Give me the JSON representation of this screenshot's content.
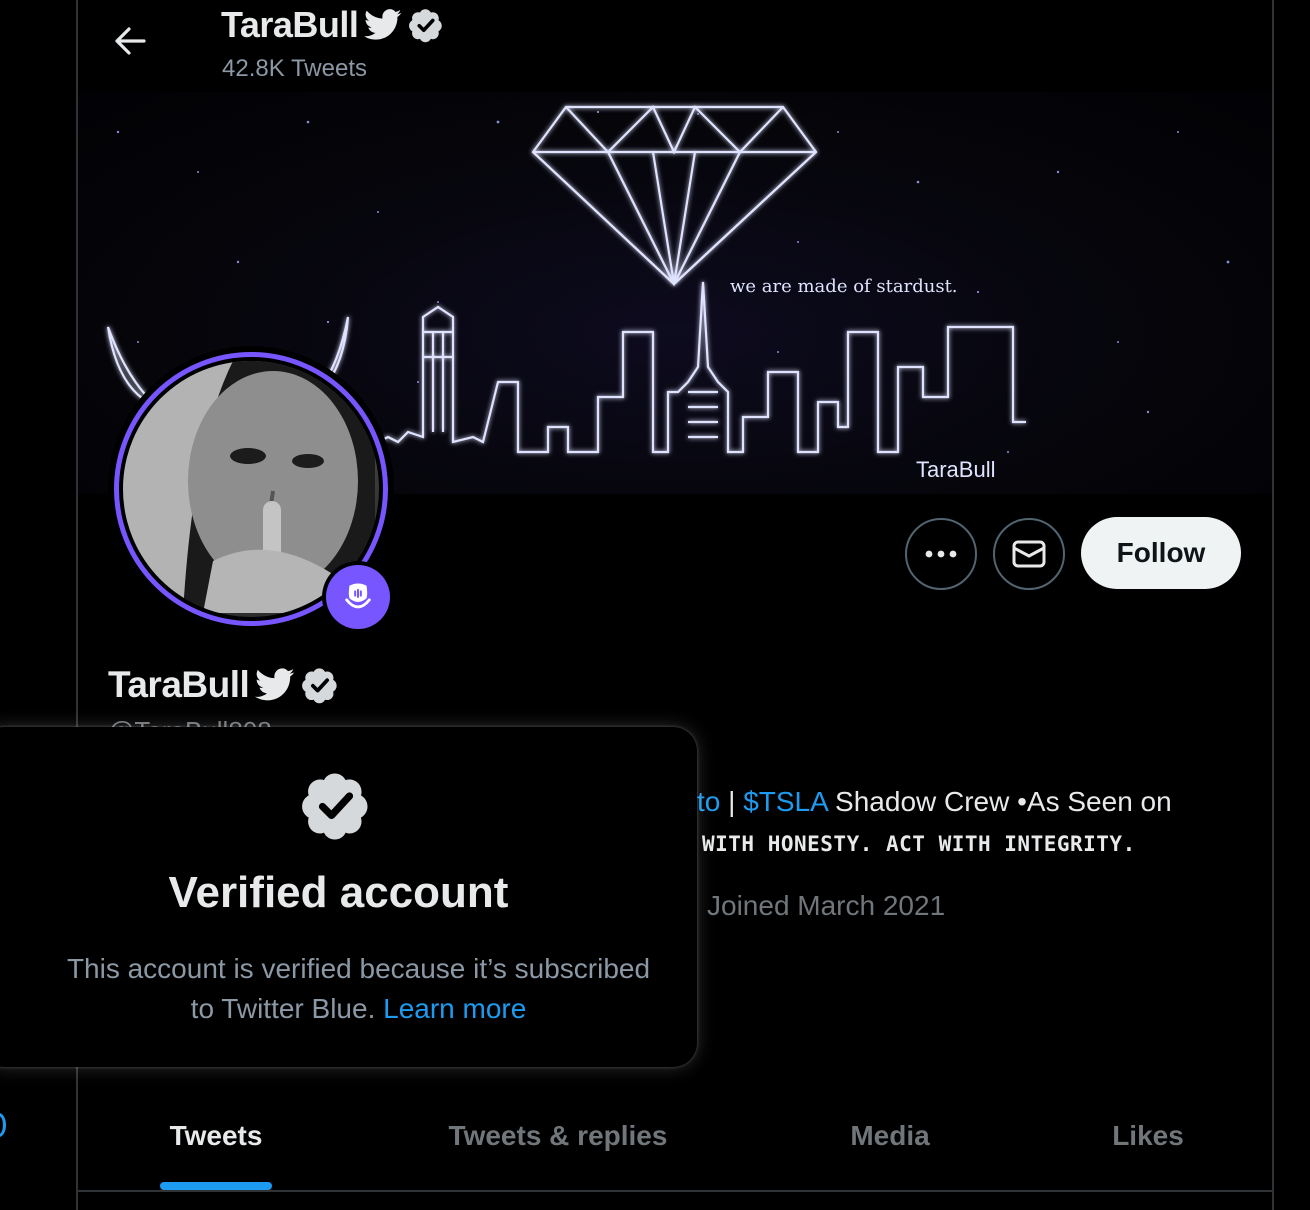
{
  "header": {
    "name": "TaraBull",
    "tweet_count": "42.8K Tweets"
  },
  "banner": {
    "tagline": "we are made of stardust.",
    "signature": "TaraBull"
  },
  "profile": {
    "name": "TaraBull",
    "handle": "@TaraBull808",
    "bio_fragment": "to",
    "bio_separator": " | ",
    "bio_link": "$TSLA",
    "bio_rest": " Shadow Crew •As Seen on",
    "bio_line2": "WITH HONESTY. ACT WITH INTEGRITY.",
    "joined": "Joined March 2021"
  },
  "actions": {
    "follow_label": "Follow"
  },
  "tabs": [
    {
      "label": "Tweets",
      "active": true
    },
    {
      "label": "Tweets & replies",
      "active": false
    },
    {
      "label": "Media",
      "active": false
    },
    {
      "label": "Likes",
      "active": false
    }
  ],
  "verified_card": {
    "title": "Verified account",
    "description_line1": "This account is verified because it’s subscribed",
    "description_line2": "to Twitter Blue.",
    "learn_more": "Learn more"
  },
  "colors": {
    "accent": "#1d9bf0",
    "spaces_purple": "#7856ff",
    "background": "#000000"
  },
  "icons": {
    "back": "arrow-left-icon",
    "bird": "twitter-bird-icon",
    "verified": "verified-badge-icon",
    "more": "more-horizontal-icon",
    "message": "envelope-icon",
    "spaces": "spaces-mic-icon"
  }
}
